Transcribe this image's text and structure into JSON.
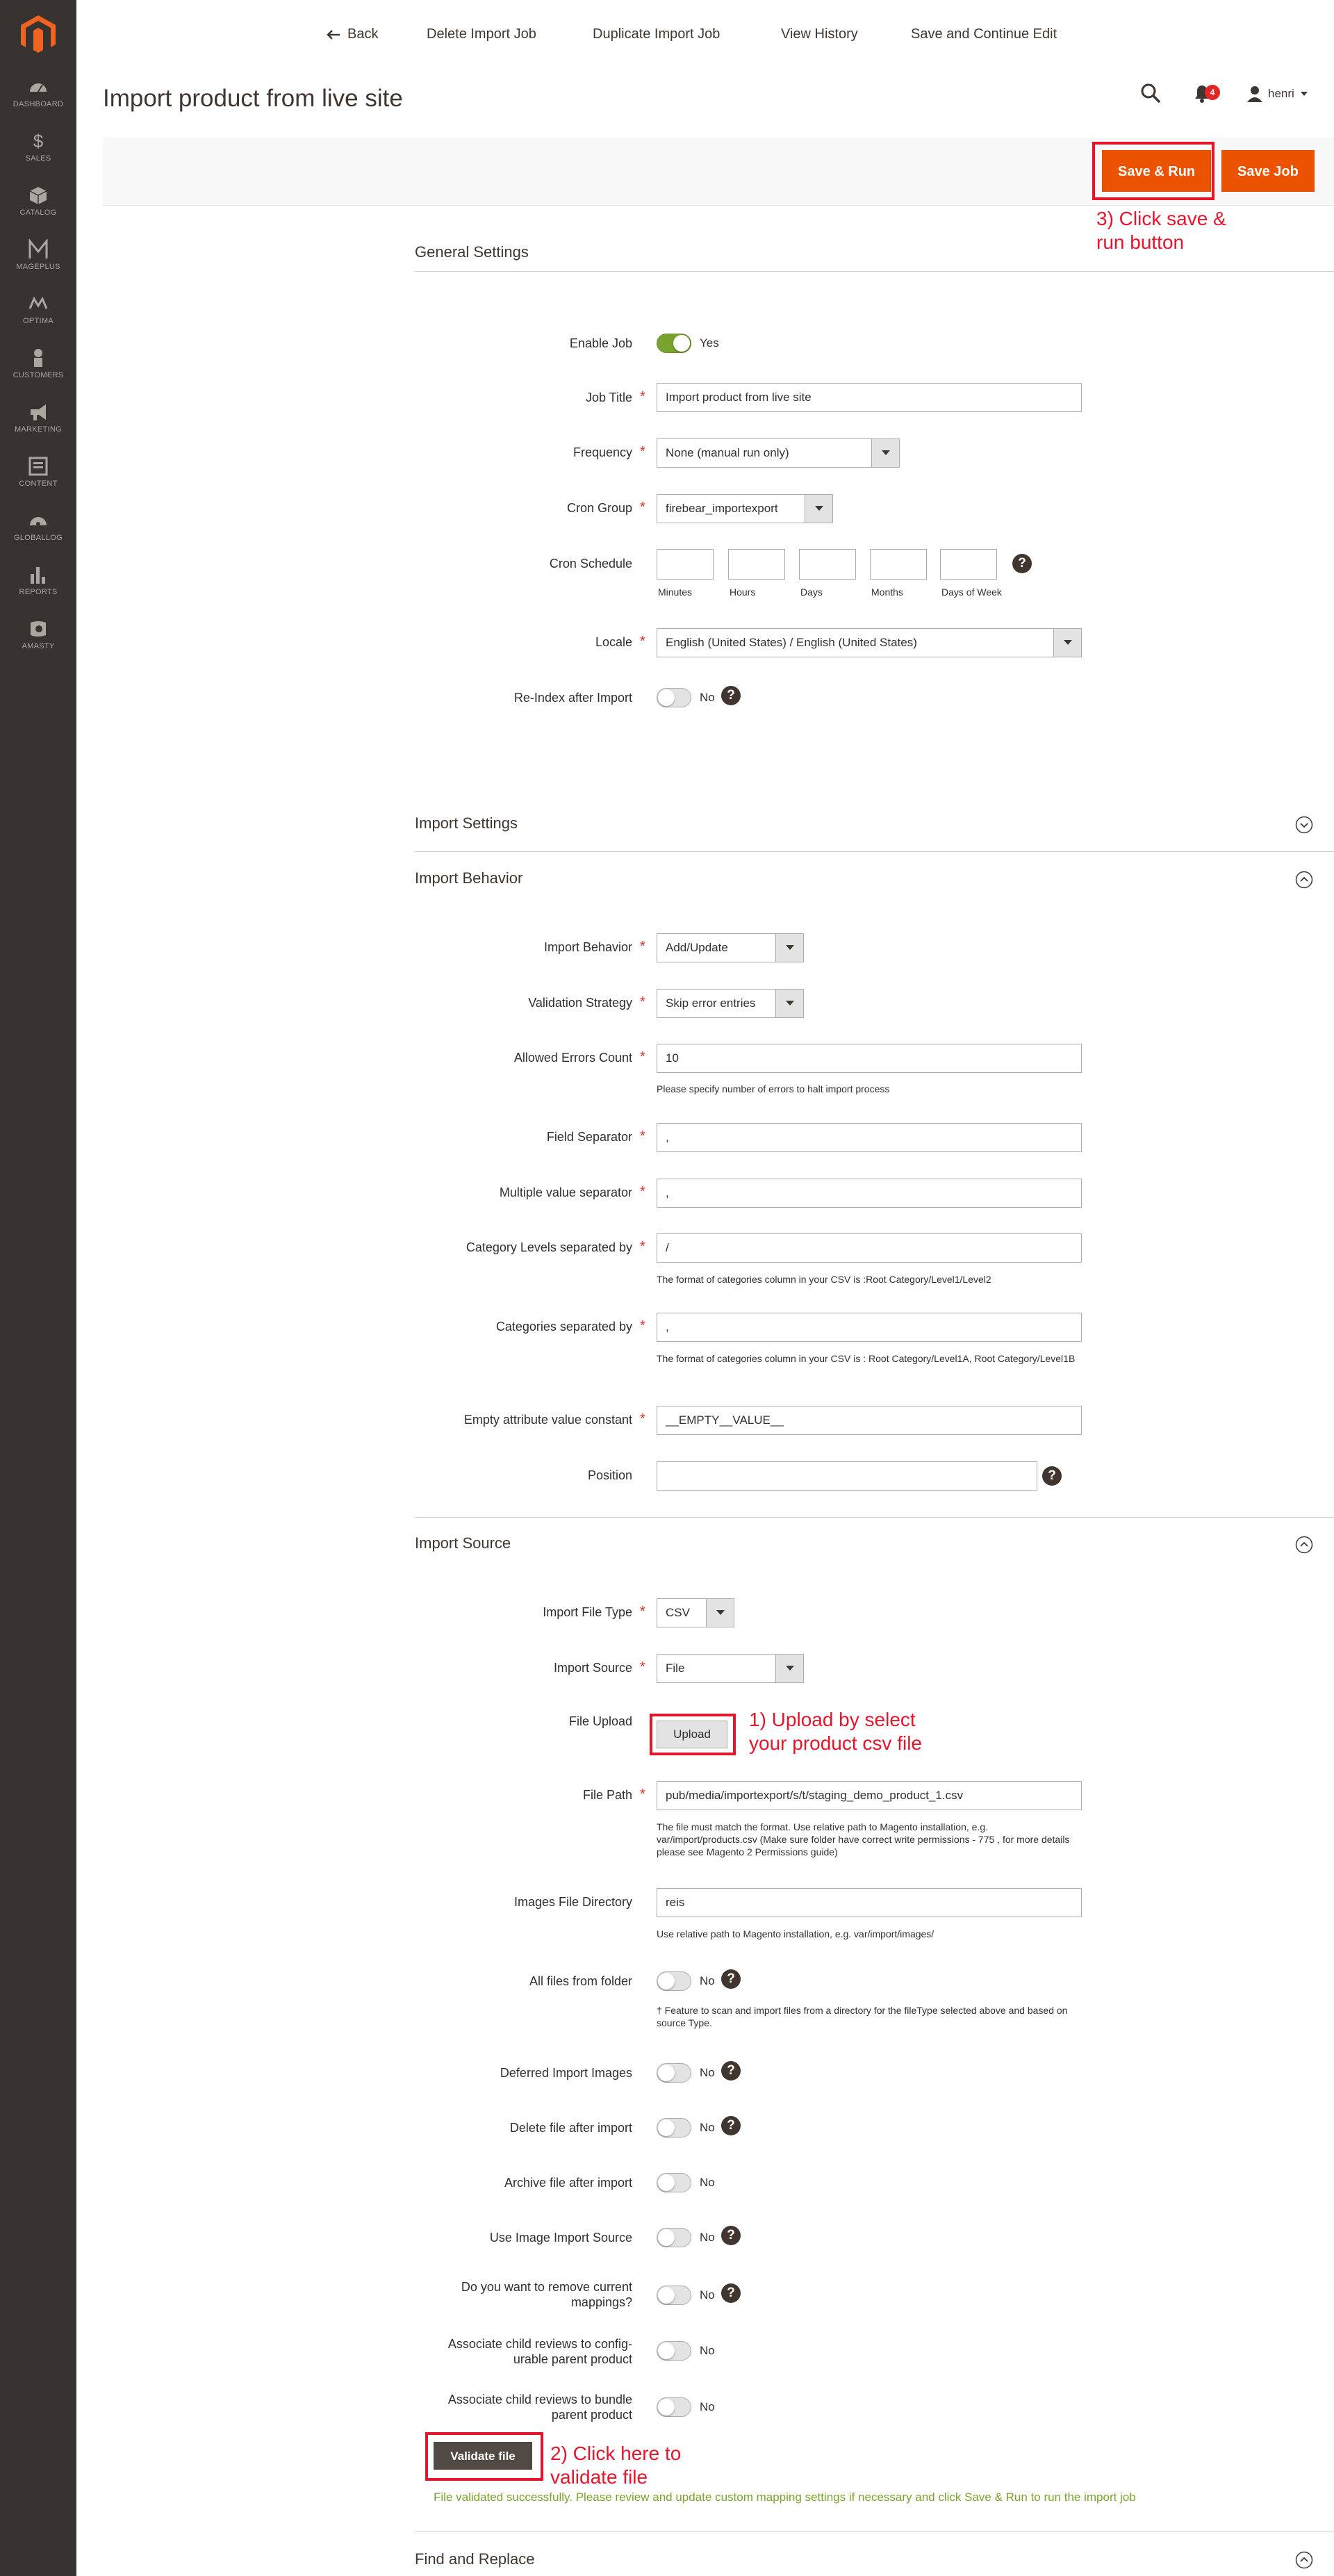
{
  "sidebar": {
    "items": [
      {
        "label": "DASHBOARD",
        "icon": "dashboard-icon"
      },
      {
        "label": "SALES",
        "icon": "dollar-icon"
      },
      {
        "label": "CATALOG",
        "icon": "cube-icon"
      },
      {
        "label": "MAGEPLUS",
        "icon": "mageplus-icon"
      },
      {
        "label": "OPTIMA",
        "icon": "optima-icon"
      },
      {
        "label": "CUSTOMERS",
        "icon": "person-icon"
      },
      {
        "label": "MARKETING",
        "icon": "megaphone-icon"
      },
      {
        "label": "CONTENT",
        "icon": "content-icon"
      },
      {
        "label": "GLOBALLOG",
        "icon": "gauge-icon"
      },
      {
        "label": "REPORTS",
        "icon": "bar-chart-icon"
      },
      {
        "label": "AMASTY",
        "icon": "amasty-icon"
      }
    ]
  },
  "header": {
    "title": "Import product from live site",
    "notifications": "4",
    "user": "henri"
  },
  "actions": {
    "back": "Back",
    "delete": "Delete Import Job",
    "duplicate": "Duplicate Import Job",
    "history": "View History",
    "save_continue": "Save and Continue Edit",
    "save_run": "Save & Run",
    "save_job": "Save Job"
  },
  "annotations": {
    "save_run": "3) Click save &\nrun button",
    "upload": "1) Upload by select\nyour product csv file",
    "validate": "2) Click here to\nvalidate file"
  },
  "general": {
    "title": "General Settings",
    "enable_job": {
      "label": "Enable Job",
      "value": "Yes"
    },
    "job_title": {
      "label": "Job Title",
      "value": "Import product from live site"
    },
    "frequency": {
      "label": "Frequency",
      "value": "None (manual run only)"
    },
    "cron_group": {
      "label": "Cron Group",
      "value": "firebear_importexport"
    },
    "cron_schedule": {
      "label": "Cron Schedule",
      "fields": [
        "Minutes",
        "Hours",
        "Days",
        "Months",
        "Days of Week"
      ]
    },
    "locale": {
      "label": "Locale",
      "value": "English (United States) / English (United States)"
    },
    "reindex": {
      "label": "Re-Index after Import",
      "value": "No"
    }
  },
  "import_settings": {
    "title": "Import Settings"
  },
  "behavior": {
    "title": "Import Behavior",
    "import_behavior": {
      "label": "Import Behavior",
      "value": "Add/Update"
    },
    "validation": {
      "label": "Validation Strategy",
      "value": "Skip error entries"
    },
    "allowed_errors": {
      "label": "Allowed Errors Count",
      "value": "10",
      "note": "Please specify number of errors to halt import process"
    },
    "field_sep": {
      "label": "Field Separator",
      "value": ","
    },
    "multi_sep": {
      "label": "Multiple value separator",
      "value": ","
    },
    "cat_levels": {
      "label": "Category Levels separated by",
      "value": "/",
      "note": "The format of categories column in your CSV is :Root Category/Level1/Level2"
    },
    "cat_sep": {
      "label": "Categories separated by",
      "value": ",",
      "note": "The format of categories column in your CSV is : Root Category/Level1A, Root Category/Level1B"
    },
    "empty_attr": {
      "label": "Empty attribute value constant",
      "value": "__EMPTY__VALUE__"
    },
    "position": {
      "label": "Position",
      "value": ""
    }
  },
  "source": {
    "title": "Import Source",
    "file_type": {
      "label": "Import File Type",
      "value": "CSV"
    },
    "import_source": {
      "label": "Import Source",
      "value": "File"
    },
    "file_upload": {
      "label": "File Upload",
      "button": "Upload"
    },
    "file_path": {
      "label": "File Path",
      "value": "pub/media/importexport/s/t/staging_demo_product_1.csv",
      "note": "The file must match the format. Use relative path to Magento installation, e.g. var/import/products.csv (Make sure folder have correct write permissions - 775 , for more details please see Magento 2 Permissions guide)"
    },
    "images_dir": {
      "label": "Images File Directory",
      "value": "reis",
      "note": "Use relative path to Magento installation, e.g. var/import/images/"
    },
    "all_files": {
      "label": "All files from folder",
      "value": "No",
      "note": "† Feature to scan and import files from a directory for the fileType selected above and based on source Type."
    },
    "deferred": {
      "label": "Deferred Import Images",
      "value": "No"
    },
    "delete_after": {
      "label": "Delete file after import",
      "value": "No"
    },
    "archive_after": {
      "label": "Archive file after import",
      "value": "No"
    },
    "image_source": {
      "label": "Use Image Import Source",
      "value": "No"
    },
    "remove_mappings": {
      "label": "Do you want to remove current mappings?",
      "value": "No"
    },
    "child_config": {
      "label": "Associate child reviews to config-urable parent product",
      "value": "No"
    },
    "child_bundle": {
      "label": "Associate child reviews to bundle parent product",
      "value": "No"
    },
    "validate_button": "Validate file",
    "success": "File validated successfully. Please review and update custom mapping settings if necessary and click Save & Run to run the import job"
  },
  "find_replace": {
    "title": "Find and Replace"
  },
  "colors": {
    "accent": "#eb5202",
    "sidebar": "#373330",
    "annotation": "#e5162c",
    "success": "#79a22e"
  }
}
